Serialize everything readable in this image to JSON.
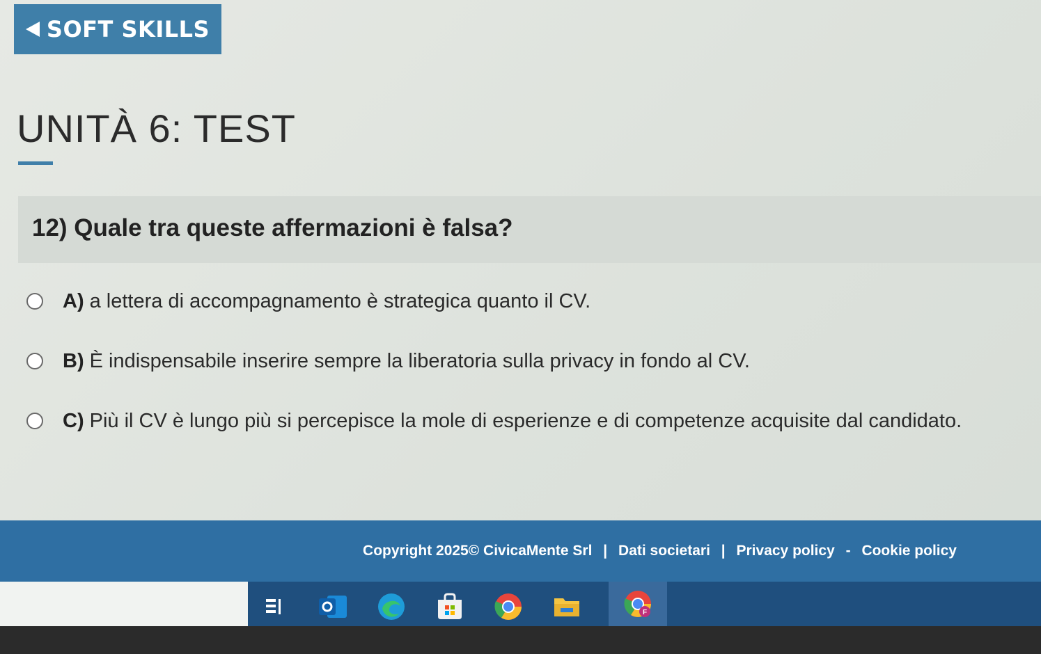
{
  "nav": {
    "back_label": "SOFT SKILLS"
  },
  "page": {
    "title": "UNITÀ 6: TEST"
  },
  "question": {
    "text": "12) Quale tra queste affermazioni è falsa?",
    "answers": [
      {
        "letter": "A)",
        "text": "a lettera di accompagnamento è strategica quanto il CV."
      },
      {
        "letter": "B)",
        "text": "È indispensabile inserire sempre la liberatoria sulla privacy in fondo al CV."
      },
      {
        "letter": "C)",
        "text": "Più il CV è lungo più si percepisce la mole di esperienze e di competenze acquisite dal candidato."
      }
    ]
  },
  "footer": {
    "copyright": "Copyright 2025© CivicaMente Srl",
    "separator": "|",
    "dati_societari": "Dati societari",
    "privacy_policy": "Privacy policy",
    "dash": "-",
    "cookie_policy": "Cookie policy"
  },
  "taskbar": {
    "icons": [
      "task-view-icon",
      "outlook-icon",
      "edge-icon",
      "store-icon",
      "chrome-icon",
      "file-explorer-icon",
      "chrome-profile-icon"
    ],
    "active_icon": "chrome-profile-icon",
    "chrome_profile_letter": "F"
  },
  "colors": {
    "accent": "#3f7fa9",
    "footer_bg": "#2f6fa3",
    "taskbar_bg": "#1f4f7e"
  }
}
